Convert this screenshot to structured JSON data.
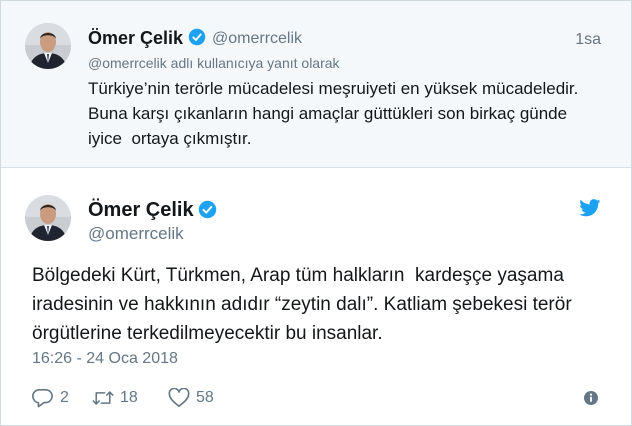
{
  "parent_tweet": {
    "author_name": "Ömer Çelik",
    "author_handle": "@omerrcelik",
    "relative_time": "1sa",
    "reply_context": "@omerrcelik adlı kullanıcıya yanıt olarak",
    "text_lines": [
      "Türkiye’nin terörle mücadelesi meşruiyeti en yüksek mücadeledir.",
      "Buna karşı çıkanların hangi amaçlar güttükleri son birkaç günde",
      "iyice  ortaya çıkmıştır."
    ]
  },
  "main_tweet": {
    "author_name": "Ömer Çelik",
    "author_handle": "@omerrcelik",
    "text_lines": [
      "Bölgedeki Kürt, Türkmen, Arap tüm halkların  kardeşçe yaşama",
      "iradesinin ve hakkının adıdır “zeytin dalı”. Katliam şebekesi terör",
      "örgütlerine terkedilmeyecektir bu insanlar."
    ],
    "timestamp": "16:26 - 24 Oca 2018",
    "reply_count": "2",
    "retweet_count": "18",
    "like_count": "58"
  },
  "icons": {
    "verified": "verified-badge-icon",
    "bird": "twitter-bird-icon",
    "reply": "reply-icon",
    "retweet": "retweet-icon",
    "like": "heart-icon",
    "info": "info-icon"
  },
  "colors": {
    "twitter_blue": "#1da1f2",
    "secondary_text": "#657786",
    "parent_background": "#f5f8fa"
  }
}
